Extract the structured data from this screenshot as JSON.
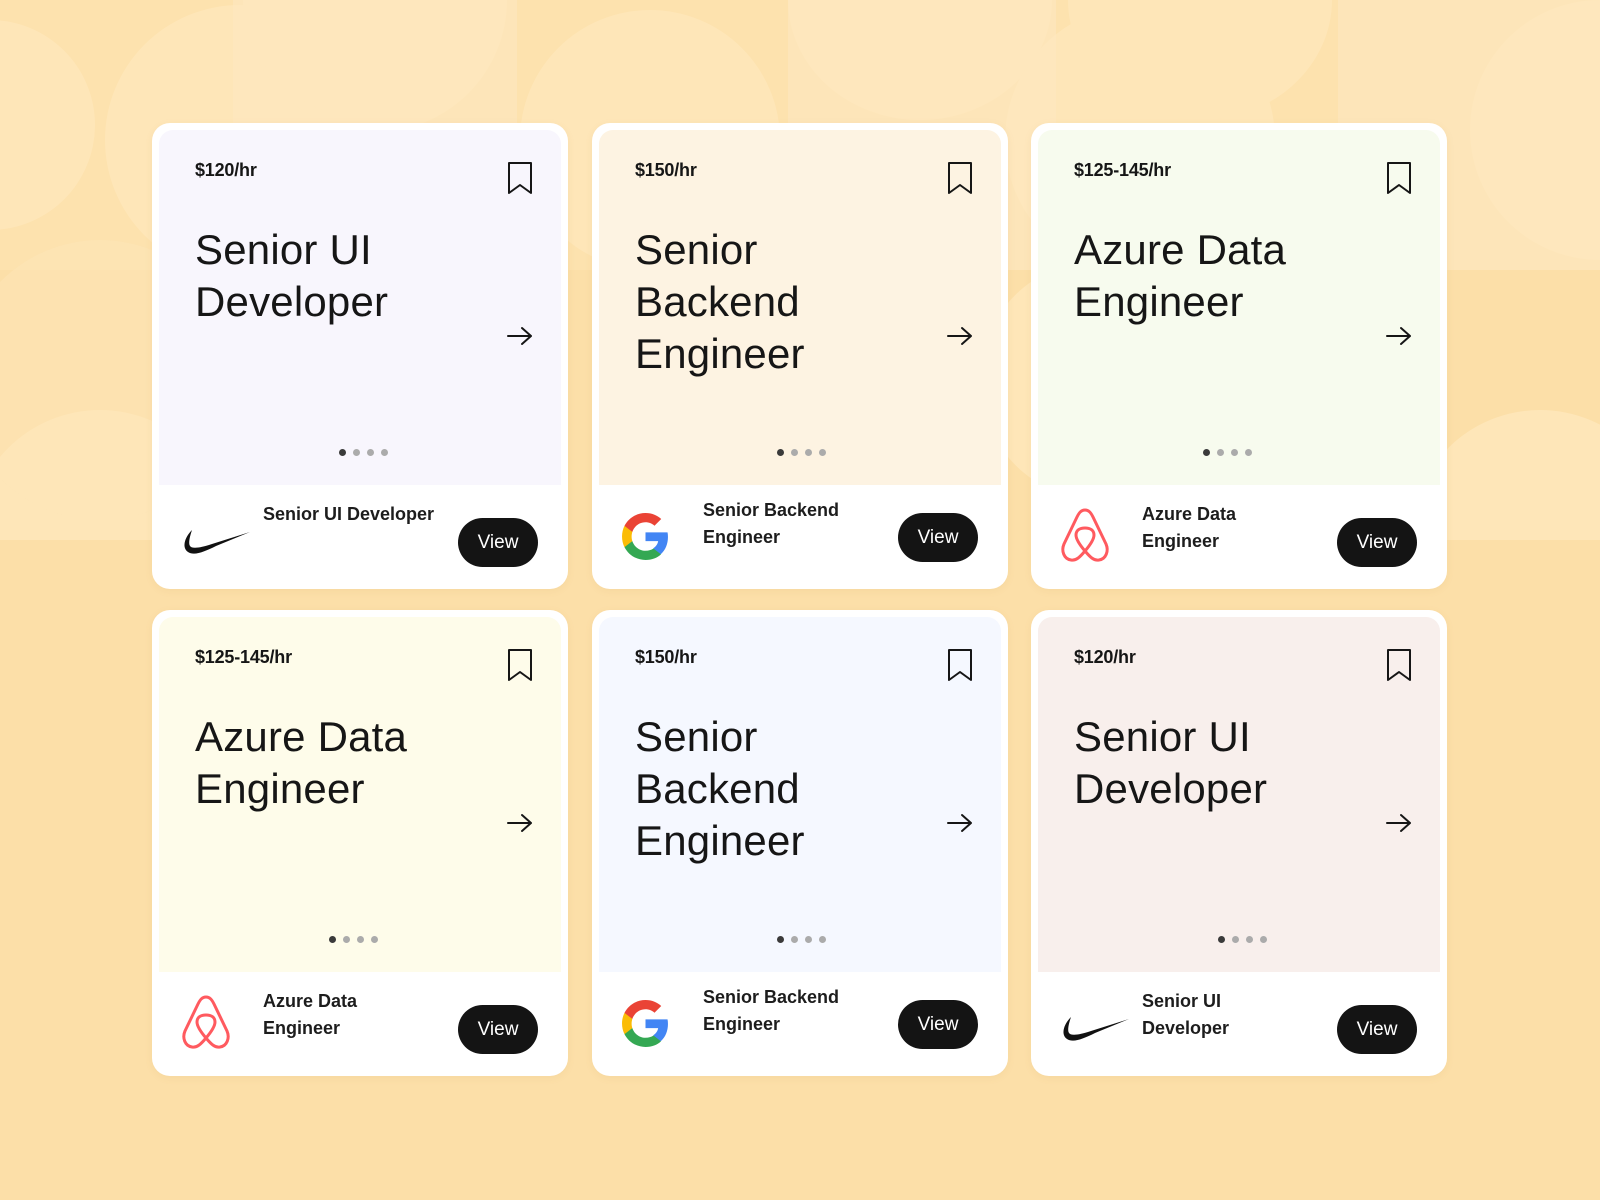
{
  "colors": {
    "background": "#FCDFA8",
    "button": "#141414",
    "airbnb": "#FF5A5F"
  },
  "cards": [
    {
      "price": "$120/hr",
      "title": "Senior UI Developer",
      "company_logo": "nike-logo",
      "footer_title": "Senior UI Developer",
      "view_label": "View",
      "panel_color": "#F8F6FD",
      "active_page": 1,
      "page_count": 4
    },
    {
      "price": "$150/hr",
      "title": "Senior Backend Engineer",
      "company_logo": "google-logo",
      "footer_title": "Senior Backend Engineer",
      "view_label": "View",
      "panel_color": "#FDF3E2",
      "active_page": 1,
      "page_count": 4
    },
    {
      "price": "$125-145/hr",
      "title": "Azure Data Engineer",
      "company_logo": "airbnb-logo",
      "footer_title": "Azure Data Engineer",
      "view_label": "View",
      "panel_color": "#F7FBEE",
      "active_page": 1,
      "page_count": 4
    },
    {
      "price": "$125-145/hr",
      "title": "Azure Data Engineer",
      "company_logo": "airbnb-logo",
      "footer_title": "Azure Data Engineer",
      "view_label": "View",
      "panel_color": "#FEFCEA",
      "active_page": 1,
      "page_count": 4
    },
    {
      "price": "$150/hr",
      "title": "Senior Backend Engineer",
      "company_logo": "google-logo",
      "footer_title": "Senior Backend Engineer",
      "view_label": "View",
      "panel_color": "#F5F8FF",
      "active_page": 1,
      "page_count": 4
    },
    {
      "price": "$120/hr",
      "title": "Senior UI Developer",
      "company_logo": "nike-logo",
      "footer_title": "Senior UI Developer",
      "view_label": "View",
      "panel_color": "#F8EFEC",
      "active_page": 1,
      "page_count": 4
    }
  ]
}
